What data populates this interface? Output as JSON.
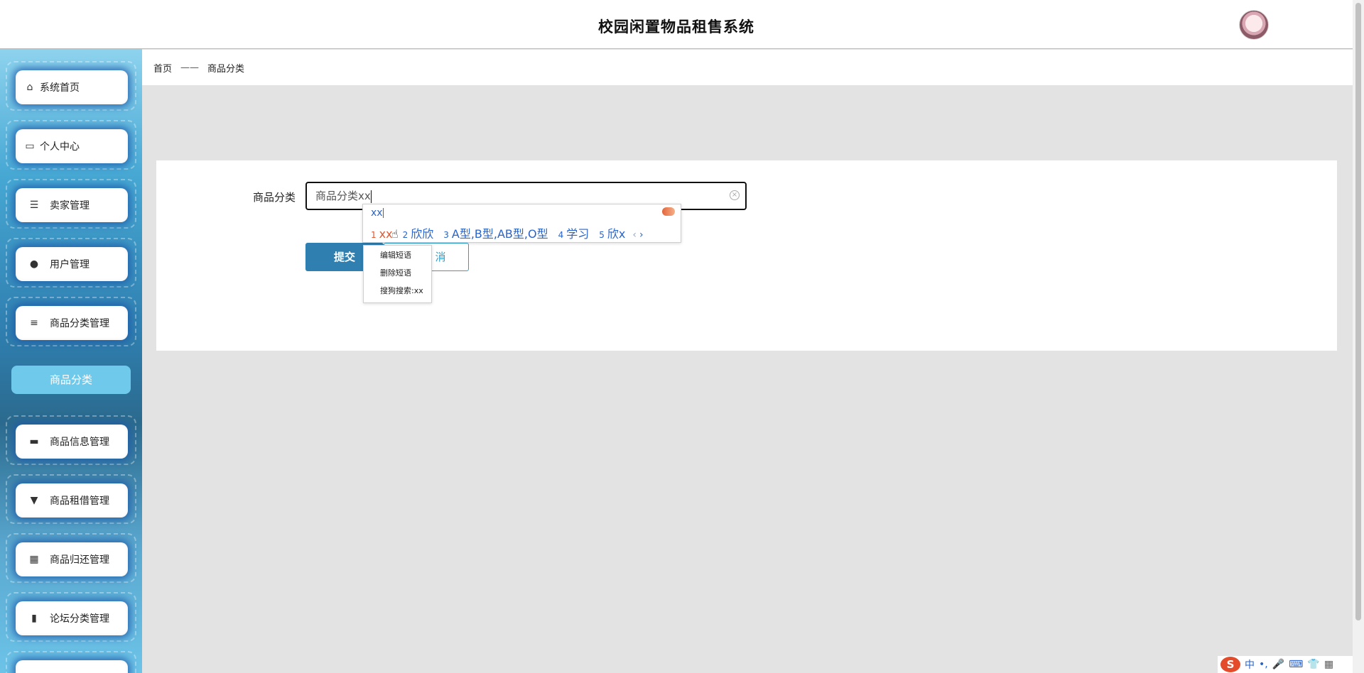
{
  "header": {
    "title": "校园闲置物品租售系统"
  },
  "sidebar": {
    "items": [
      {
        "label": "系统首页",
        "icon": "home-icon"
      },
      {
        "label": "个人中心",
        "icon": "card-icon"
      },
      {
        "label": "卖家管理",
        "icon": "list-icon"
      },
      {
        "label": "用户管理",
        "icon": "user-icon"
      },
      {
        "label": "商品分类管理",
        "icon": "menu-icon"
      },
      {
        "label": "商品信息管理",
        "icon": "monitor-icon"
      },
      {
        "label": "商品租借管理",
        "icon": "brush-icon"
      },
      {
        "label": "商品归还管理",
        "icon": "grid-icon"
      },
      {
        "label": "论坛分类管理",
        "icon": "books-icon"
      }
    ],
    "active_subitem": "商品分类"
  },
  "breadcrumb": {
    "home": "首页",
    "separator": "——",
    "current": "商品分类"
  },
  "form": {
    "label": "商品分类",
    "value": "商品分类xx",
    "submit_label": "提交",
    "cancel_label": "取消",
    "cancel_visible": "消"
  },
  "ime": {
    "composition": "xx",
    "candidates": [
      {
        "index": "1",
        "text": "xx"
      },
      {
        "index": "2",
        "text": "欣欣"
      },
      {
        "index": "3",
        "text": "A型,B型,AB型,O型"
      },
      {
        "index": "4",
        "text": "学习"
      },
      {
        "index": "5",
        "text": "欣x"
      }
    ],
    "context_menu": [
      "编辑短语",
      "删除短语",
      "搜狗搜索:xx"
    ],
    "statusbar": [
      "S",
      "中",
      "•,",
      "🎤",
      "⌨",
      "👕",
      "▦"
    ]
  },
  "colors": {
    "primary": "#2f7fb0",
    "accent": "#6fc9ea",
    "ime_blue": "#2a64c8",
    "ime_active": "#e2582f"
  }
}
